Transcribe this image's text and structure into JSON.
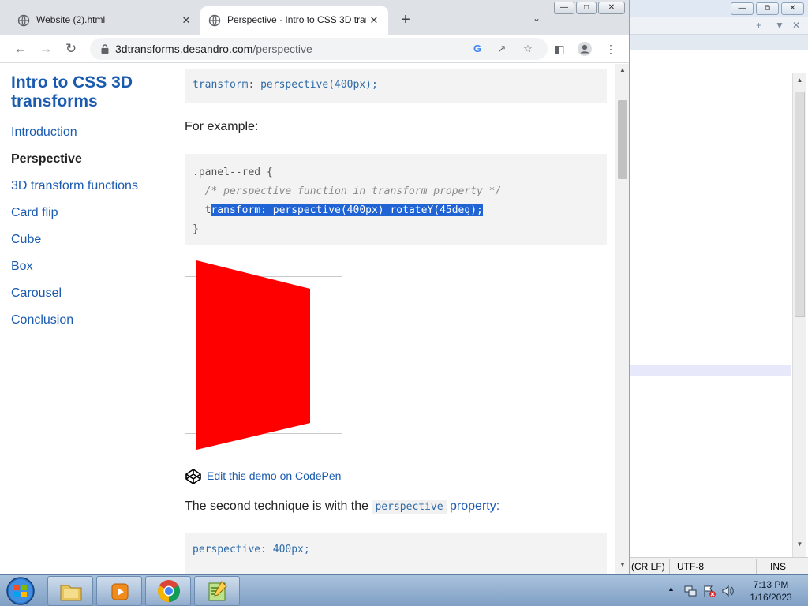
{
  "browser": {
    "tabs": [
      {
        "title": "Website (2).html",
        "active": false
      },
      {
        "title": "Perspective · Intro to CSS 3D tran",
        "active": true
      }
    ],
    "new_tab_label": "+",
    "url_host": "3dtransforms.desandro.com",
    "url_path": "/perspective"
  },
  "page": {
    "site_title": "Intro to CSS 3D transforms",
    "nav": [
      {
        "label": "Introduction",
        "current": false
      },
      {
        "label": "Perspective",
        "current": true
      },
      {
        "label": "3D transform functions",
        "current": false
      },
      {
        "label": "Card flip",
        "current": false
      },
      {
        "label": "Cube",
        "current": false
      },
      {
        "label": "Box",
        "current": false
      },
      {
        "label": "Carousel",
        "current": false
      },
      {
        "label": "Conclusion",
        "current": false
      }
    ],
    "code1": {
      "property": "transform",
      "value": "perspective(400px);"
    },
    "for_example": "For example:",
    "code2": {
      "selector": ".panel--red {",
      "comment": "/* perspective function in transform property */",
      "line_prefix": "t",
      "line_selected": "ransform: perspective(400px) rotateY(45deg);",
      "close": "}"
    },
    "panel_color": "#ff0000",
    "codepen_link": "Edit this demo on CodePen",
    "second_technique_prefix": "The second technique is with the",
    "second_technique_code": "perspective",
    "second_technique_suffix": "property:",
    "code3": {
      "property": "perspective",
      "value": "400px;"
    }
  },
  "editor": {
    "status_line_ending": "(CR LF)",
    "status_encoding": "UTF-8",
    "status_mode": "INS"
  },
  "taskbar": {
    "time": "7:13 PM",
    "date": "1/16/2023"
  }
}
